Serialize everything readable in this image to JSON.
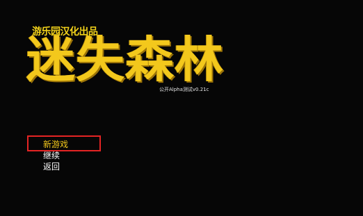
{
  "game": {
    "publisher_credit": "游乐园汉化出品",
    "title": "迷失森林",
    "version_text": "公开Alpha测试v0.21c"
  },
  "main_menu": {
    "items": [
      {
        "label": "新游戏",
        "selected": true
      },
      {
        "label": "继续",
        "selected": false
      },
      {
        "label": "返回",
        "selected": false
      }
    ]
  },
  "colors": {
    "background": "#060606",
    "title_yellow": "#f3c81c",
    "menu_text": "#ffffff",
    "selection_box": "#e52424"
  }
}
